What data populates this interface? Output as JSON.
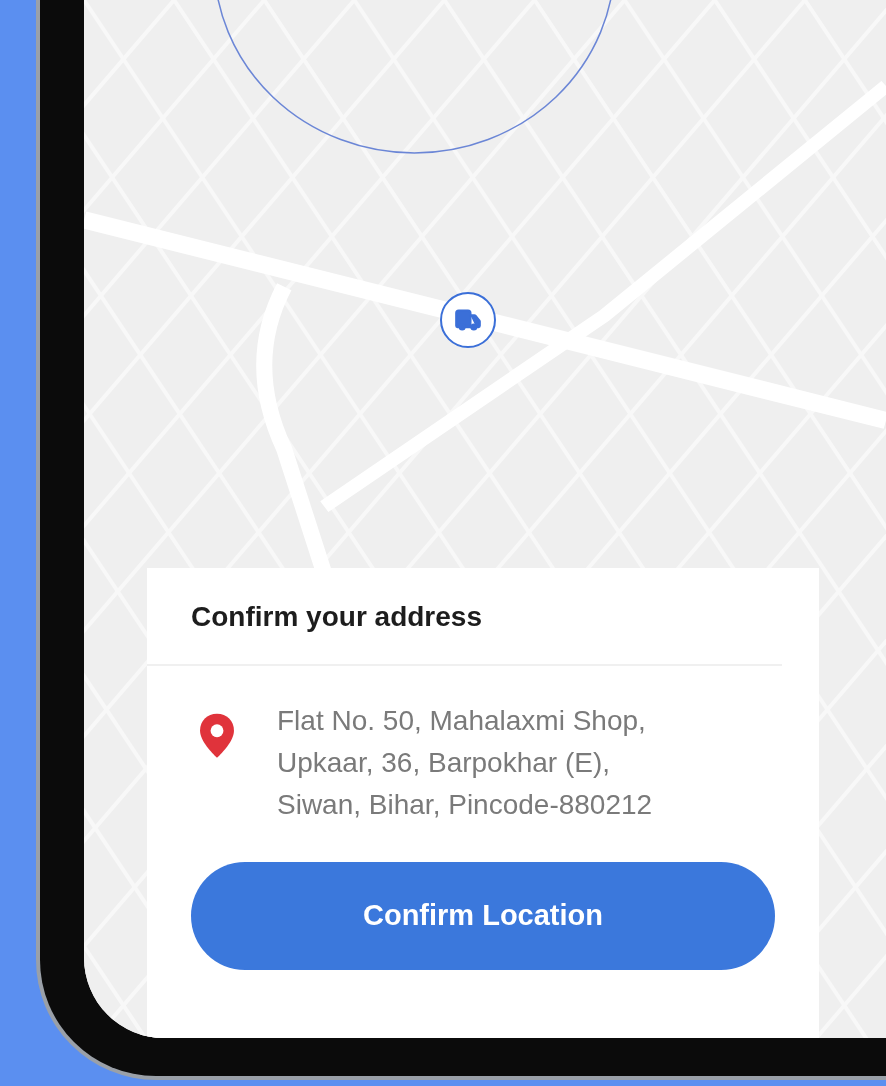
{
  "address_card": {
    "title": "Confirm your address",
    "address": "Flat No. 50, Mahalaxmi Shop, Upkaar, 36, Barpokhar (E), Siwan, Bihar, Pincode-880212",
    "button": "Confirm Location"
  }
}
